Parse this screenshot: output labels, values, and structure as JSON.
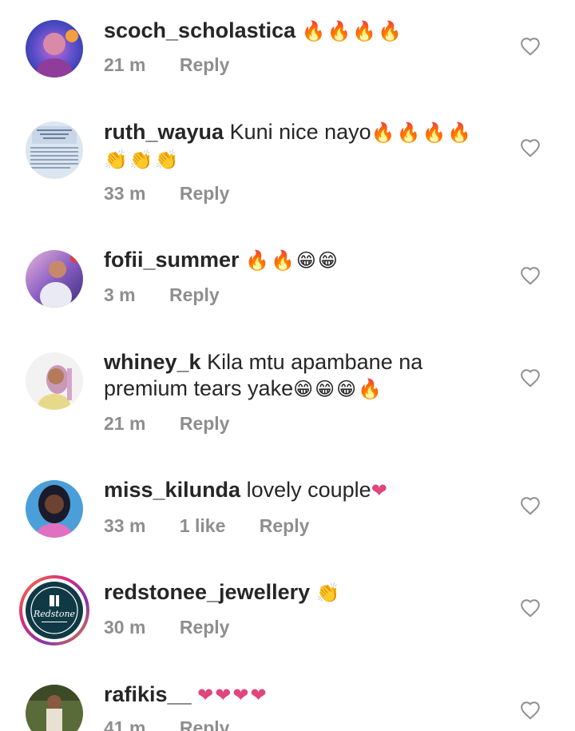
{
  "comments": [
    {
      "username": "scoch_scholastica",
      "text": "",
      "emoji": "🔥🔥🔥🔥",
      "time": "21 m",
      "likes": "",
      "reply": "Reply"
    },
    {
      "username": "ruth_wayua",
      "text": "Kuni nice nayo",
      "emoji": "🔥🔥🔥🔥",
      "emoji2": "👏👏👏",
      "time": "33 m",
      "likes": "",
      "reply": "Reply"
    },
    {
      "username": "fofii_summer",
      "text": "",
      "emoji": "🔥🔥😁😁",
      "time": "3 m",
      "likes": "",
      "reply": "Reply"
    },
    {
      "username": "whiney_k",
      "text": "Kila mtu apambane na",
      "text2": "premium tears yake",
      "emoji": "😁😁😁🔥",
      "time": "21 m",
      "likes": "",
      "reply": "Reply"
    },
    {
      "username": "miss_kilunda",
      "text": "lovely couple",
      "emoji": "❤",
      "time": "33 m",
      "likes": "1 like",
      "reply": "Reply"
    },
    {
      "username": "redstonee_jewellery",
      "text": "",
      "emoji": "👏",
      "time": "30 m",
      "likes": "",
      "reply": "Reply",
      "logo_text": "Redstone"
    },
    {
      "username": "rafikis__",
      "text": "",
      "emoji": "❤❤❤❤",
      "time": "41 m",
      "likes": "",
      "reply": "Reply"
    }
  ],
  "icons": {
    "like": "heart-outline-icon"
  },
  "colors": {
    "username": "#262626",
    "meta": "#8e8e8e",
    "heart": "#e0457b"
  }
}
